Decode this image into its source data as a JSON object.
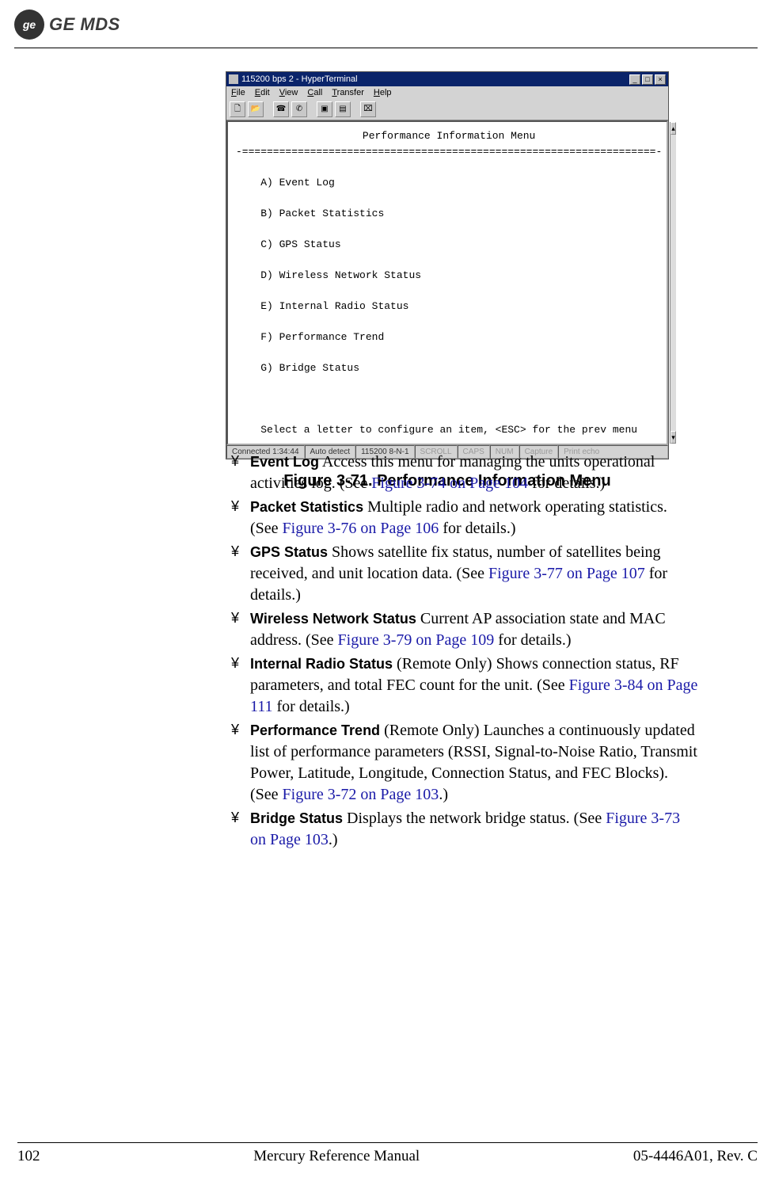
{
  "header": {
    "logo_glyph": "ge",
    "brand": "GE MDS"
  },
  "terminal": {
    "title": "115200 bps 2 - HyperTerminal",
    "menu": [
      "File",
      "Edit",
      "View",
      "Call",
      "Transfer",
      "Help"
    ],
    "screen_title": "Performance Information Menu",
    "divider": "-===================================================================-",
    "options": [
      "A) Event Log",
      "B) Packet Statistics",
      "C) GPS Status",
      "D) Wireless Network Status",
      "E) Internal Radio Status",
      "F) Performance Trend",
      "G) Bridge Status"
    ],
    "prompt": "Select a letter to configure an item, <ESC> for the prev menu",
    "status": {
      "connected": "Connected 1:34:44",
      "detect": "Auto detect",
      "settings": "115200 8-N-1",
      "dim": [
        "SCROLL",
        "CAPS",
        "NUM",
        "Capture",
        "Print echo"
      ]
    }
  },
  "figure_caption": "Figure 3-71. Performance Information Menu",
  "bullets": [
    {
      "term": "Event Log",
      "qualifier": "",
      "text_before": "Access this menu for managing the units opera­tional activities log. (See ",
      "link": "Figure 3-74 on Page 104",
      "text_after": " for details.)"
    },
    {
      "term": "Packet Statistics",
      "qualifier": "",
      "text_before": "Multiple radio and network operating statis­tics. (See ",
      "link": "Figure 3-76 on Page 106",
      "text_after": " for details.)"
    },
    {
      "term": "GPS Status",
      "qualifier": "",
      "text_before": "Shows satellite fix status, number of satellites being received, and unit location data. (See ",
      "link": "Figure 3-77 on Page 107",
      "text_after": " for details.)"
    },
    {
      "term": "Wireless Network Status",
      "qualifier": "",
      "text_before": "Current AP association state and MAC address. (See ",
      "link": "Figure 3-79 on Page 109",
      "text_after": " for details.)"
    },
    {
      "term": "Internal Radio Status",
      "qualifier": " (Remote Only)",
      "text_before": "Shows connection status, RF parameters, and total FEC count for the unit. (See ",
      "link": "Figure 3-84 on Page 111",
      "text_after": " for details.)"
    },
    {
      "term": "Performance Trend",
      "qualifier": " (Remote Only)",
      "text_before": "Launches a continuously updated list of performance parameters (RSSI, Signal-to-Noise Ratio, Transmit Power, Latitude, Longitude, Connection Status, and FEC Blocks). (See ",
      "link": "Figure 3-72 on Page 103",
      "text_after": ".)"
    },
    {
      "term": "Bridge Status",
      "qualifier": "",
      "text_before": "Displays the network bridge status. (See ",
      "link": "Figure 3-73 on Page 103",
      "text_after": ".)"
    }
  ],
  "bullet_mark": "¥",
  "footer": {
    "page": "102",
    "center": "Mercury Reference Manual",
    "right": "05-4446A01, Rev. C"
  }
}
